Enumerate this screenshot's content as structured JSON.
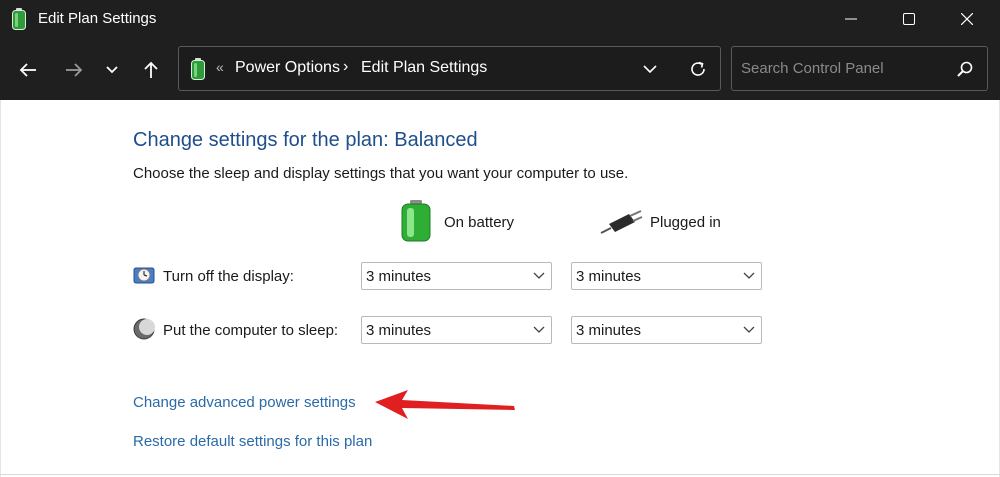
{
  "window": {
    "title": "Edit Plan Settings"
  },
  "nav": {
    "breadcrumb_sep": "«",
    "breadcrumb": [
      "Power Options",
      "Edit Plan Settings"
    ],
    "breadcrumb_chevron": "›",
    "search_placeholder": "Search Control Panel"
  },
  "page": {
    "heading": "Change settings for the plan: Balanced",
    "subtext": "Choose the sleep and display settings that you want your computer to use.",
    "columns": {
      "battery": "On battery",
      "plugged": "Plugged in"
    },
    "rows": [
      {
        "label": "Turn off the display:",
        "battery": "3 minutes",
        "plugged": "3 minutes"
      },
      {
        "label": "Put the computer to sleep:",
        "battery": "3 minutes",
        "plugged": "3 minutes"
      }
    ],
    "links": {
      "advanced": "Change advanced power settings",
      "restore": "Restore default settings for this plan"
    }
  },
  "colors": {
    "titlebar": "#1f1f1f",
    "heading": "#1f4e8c",
    "link": "#2a6aa8",
    "annotation_arrow": "#e02020",
    "battery_green": "#3cb83c"
  },
  "icons": {
    "app": "battery-icon",
    "back": "arrow-left-icon",
    "forward": "arrow-right-icon",
    "recent": "chevron-down-icon",
    "up": "arrow-up-icon",
    "refresh": "refresh-icon",
    "search": "search-icon",
    "display": "display-timer-icon",
    "sleep": "moon-icon",
    "battery_column": "battery-icon",
    "plugged_column": "plug-icon"
  }
}
